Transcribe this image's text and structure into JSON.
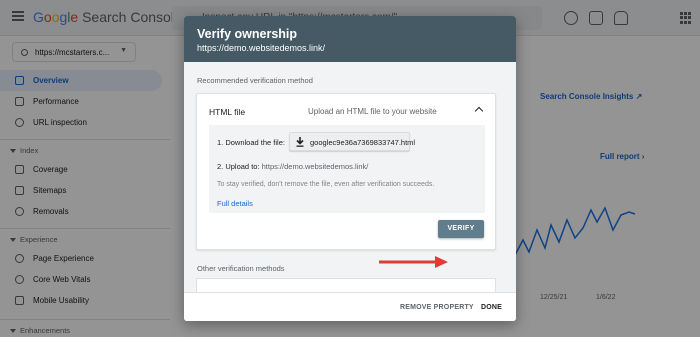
{
  "app": {
    "logo_google": "Google",
    "logo_product": "Search Console",
    "search_placeholder": "Inspect any URL in \"https://mcstarters.com/\"",
    "property": "https://mcstarters.c..."
  },
  "sidebar": {
    "items_top": [
      {
        "label": "Overview",
        "icon": "overview-icon"
      },
      {
        "label": "Performance",
        "icon": "trend-icon"
      },
      {
        "label": "URL inspection",
        "icon": "search-icon"
      }
    ],
    "section_index": "Index",
    "items_index": [
      {
        "label": "Coverage",
        "icon": "coverage-icon"
      },
      {
        "label": "Sitemaps",
        "icon": "sitemaps-icon"
      },
      {
        "label": "Removals",
        "icon": "removals-icon"
      }
    ],
    "section_experience": "Experience",
    "items_experience": [
      {
        "label": "Page Experience",
        "icon": "page-experience-icon"
      },
      {
        "label": "Core Web Vitals",
        "icon": "speed-icon"
      },
      {
        "label": "Mobile Usability",
        "icon": "mobile-icon"
      }
    ],
    "section_enhancements": "Enhancements"
  },
  "main": {
    "title_fragment": "O",
    "insights_link": "Search Console Insights",
    "full_report": "Full report",
    "x_labels": [
      "12/25/21",
      "1/6/22"
    ]
  },
  "dialog": {
    "title": "Verify ownership",
    "subtitle": "https://demo.websitedemos.link/",
    "recommended_label": "Recommended verification method",
    "method_title": "HTML file",
    "method_description": "Upload an HTML file to your website",
    "step1_label": "1. Download the file:",
    "download_file": "googlec9e36a7369833747.html",
    "step2_label": "2. Upload to:",
    "step2_url": "https://demo.websitedemos.link/",
    "note": "To stay verified, don't remove the file, even after verification succeeds.",
    "full_details": "Full details",
    "verify_button": "VERIFY",
    "other_label": "Other verification methods",
    "remove_property": "REMOVE PROPERTY",
    "done": "DONE"
  },
  "colors": {
    "header": "#455a64",
    "verify": "#5f7d8c",
    "link": "#1967d2",
    "arrow": "#e53935"
  }
}
